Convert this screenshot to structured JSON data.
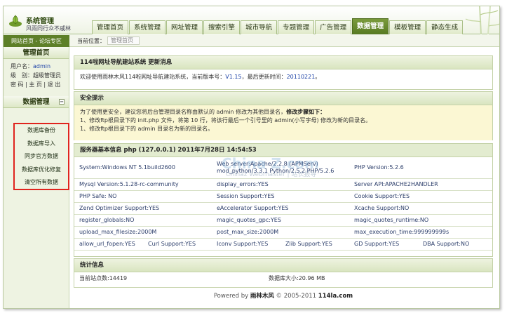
{
  "header": {
    "logo_title": "系统管理",
    "logo_subtitle": "风雨同行众不戚林",
    "tabs": [
      "管理首页",
      "系统管理",
      "网址管理",
      "搜索引擎",
      "城市导航",
      "专题管理",
      "广告管理",
      "数据管理",
      "模板管理",
      "静态生成"
    ],
    "active_tab_index": 7
  },
  "subbar": {
    "left_links": "网站首页 - 论坛专区",
    "crumb_label": "当前位置：",
    "crumb_value": "管理首页"
  },
  "sidebar": {
    "home_title": "管理首页",
    "user_label": "用户名：",
    "user_value": "admin",
    "level_label": "级　别：",
    "level_value": "超级管理员",
    "links": "密 码 | 主 页 | 退 出",
    "data_title": "数据管理",
    "collapse_symbol": "−",
    "data_items": [
      "数据库备份",
      "数据库导入",
      "同步官方数据",
      "数据库优化修复",
      "清空所有数据"
    ]
  },
  "panels": {
    "welcome_title": "114啦网址导航建站系统  更新消息",
    "welcome_text_1": "欢迎使用雨林木风114啦网址导航建站系统，当前版本号：",
    "welcome_version": "V1.15",
    "welcome_text_2": "，最后更新时间：",
    "welcome_date": "20110221",
    "welcome_text_3": "。",
    "security_title": "安全提示",
    "security_line1": "为了使用更安全，建议您将后台管理目录名称由默认的  admin  修改为其他目录名，",
    "security_line1_bold": "修改步骤如下：",
    "security_line2": "1、修改ftp根目录下的  init.php 文件，将第  10 行，将该行最后一个引号里的  admin(小写字母)  修改为新的目录名。",
    "security_line3": "1、修改ftp根目录下的  admin 目录名为新的目录名。",
    "server_title": "服务器基本信息  php (127.0.0.1)  2011年7月28日  14:54:53",
    "watermark_big": "China Z.com",
    "watermark_small": "Chinaz Webmaster | 站长报导",
    "server_rows": [
      [
        "System:Windows NT 5.1build2600",
        "",
        "Web server:Apache/2.2.8 (APMServ) mod_python/3.3.1 Python/2.5.2 PHP/5.2.6",
        "",
        "PHP Version:5.2.6",
        ""
      ],
      [
        "Mysql Version:5.1.28-rc-community",
        "",
        "display_errors:YES",
        "",
        "Server API:APACHE2HANDLER",
        ""
      ],
      [
        "PHP Safe: NO",
        "",
        "Session Support:YES",
        "",
        "Cookie Support:YES",
        ""
      ],
      [
        "Zend Optimizer Support:YES",
        "",
        "eAccelerator Support:YES",
        "",
        "Xcache Support:NO",
        ""
      ],
      [
        "register_globals:NO",
        "",
        "magic_quotes_gpc:YES",
        "",
        "magic_quotes_runtime:NO",
        ""
      ],
      [
        "upload_max_filesize:2000M",
        "",
        "post_max_size:2000M",
        "",
        "max_execution_time:999999999s",
        ""
      ],
      [
        "allow_url_fopen:YES",
        "Curl Support:YES",
        "Iconv Support:YES",
        "Zlib Support:YES",
        "GD Support:YES",
        "DBA Support:NO"
      ]
    ],
    "stats_title": "统计信息",
    "stats_sites": "当前站点数:14419",
    "stats_db": "数据库大小:20.96 MB"
  },
  "footer": {
    "prefix": "Powered by ",
    "brand": "雨林木风",
    "suffix": " © 2005-2011 ",
    "site": "114la.com"
  }
}
